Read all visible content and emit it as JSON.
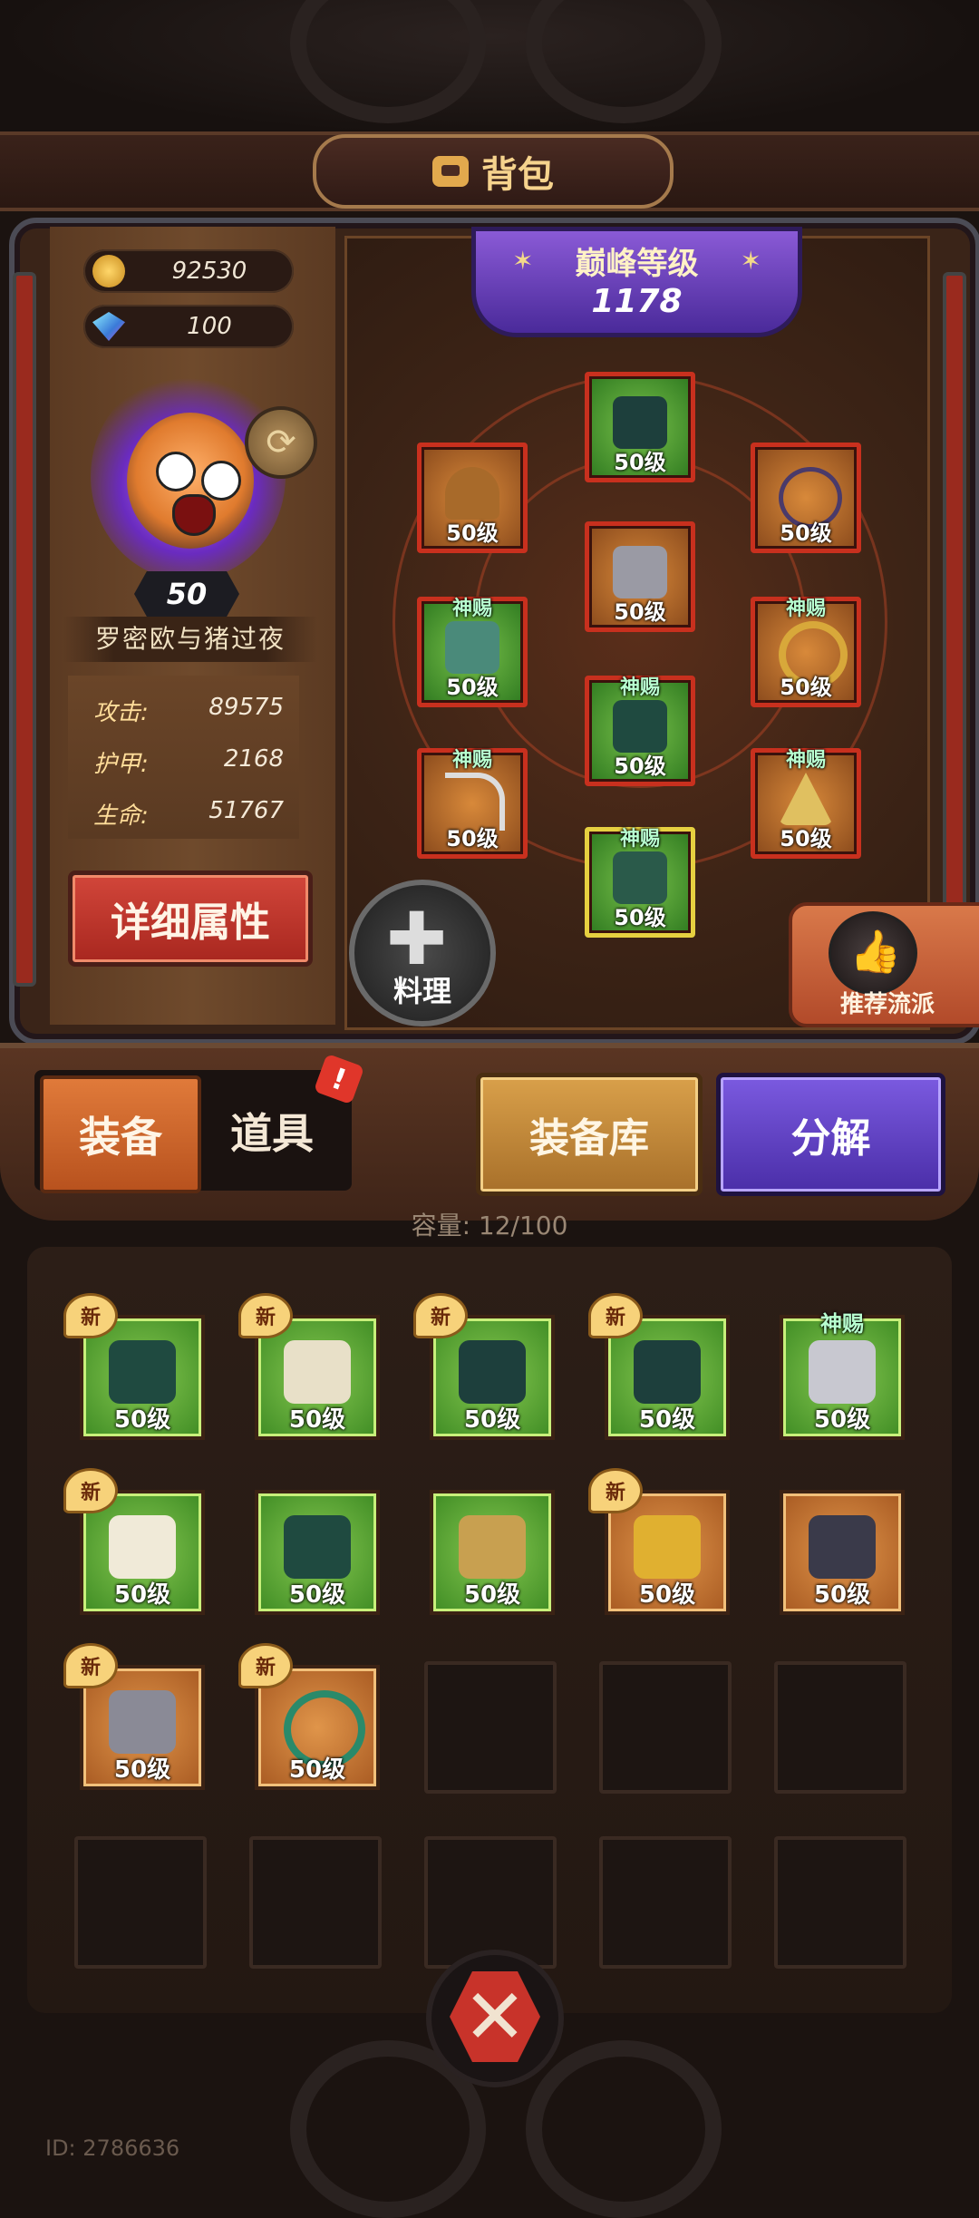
{
  "header": {
    "title": "背包"
  },
  "currency": {
    "gold": "92530",
    "gems": "100"
  },
  "hero": {
    "level": "50",
    "name": "罗密欧与猪过夜",
    "stats": [
      {
        "label": "攻击:",
        "value": "89575"
      },
      {
        "label": "护甲:",
        "value": "2168"
      },
      {
        "label": "生命:",
        "value": "51767"
      }
    ],
    "detail_button": "详细属性"
  },
  "peak": {
    "label": "巅峰等级",
    "value": "1178"
  },
  "equipped": {
    "head": {
      "level": "50级"
    },
    "left_top": {
      "level": "50级"
    },
    "right_top": {
      "level": "50级"
    },
    "chest": {
      "level": "50级"
    },
    "left_mid": {
      "tag": "神赐",
      "level": "50级"
    },
    "right_mid": {
      "tag": "神赐",
      "level": "50级"
    },
    "legs": {
      "tag": "神赐",
      "level": "50级"
    },
    "left_bot": {
      "tag": "神赐",
      "level": "50级"
    },
    "right_bot": {
      "tag": "神赐",
      "level": "50级"
    },
    "boots": {
      "tag": "神赐",
      "level": "50级"
    }
  },
  "cook_button": "料理",
  "recommend_button": "推荐流派",
  "tabs": {
    "equipment": "装备",
    "items": "道具",
    "alert": "!"
  },
  "armory_button": "装备库",
  "decompose_button": "分解",
  "capacity": "容量: 12/100",
  "inventory": [
    {
      "badge": "新",
      "level": "50级"
    },
    {
      "badge": "新",
      "level": "50级"
    },
    {
      "badge": "新",
      "level": "50级"
    },
    {
      "badge": "新",
      "level": "50级"
    },
    {
      "tag": "神赐",
      "level": "50级"
    },
    {
      "badge": "新",
      "level": "50级"
    },
    {
      "level": "50级"
    },
    {
      "level": "50级"
    },
    {
      "badge": "新",
      "level": "50级"
    },
    {
      "level": "50级"
    },
    {
      "badge": "新",
      "level": "50级"
    },
    {
      "badge": "新",
      "level": "50级"
    }
  ],
  "user_id": "ID: 2786636",
  "colors": {
    "slot_red": "#c8301e",
    "green_rarity": "#5aa836",
    "orange_rarity": "#c87a34",
    "purple_button": "#5a3ac0"
  }
}
